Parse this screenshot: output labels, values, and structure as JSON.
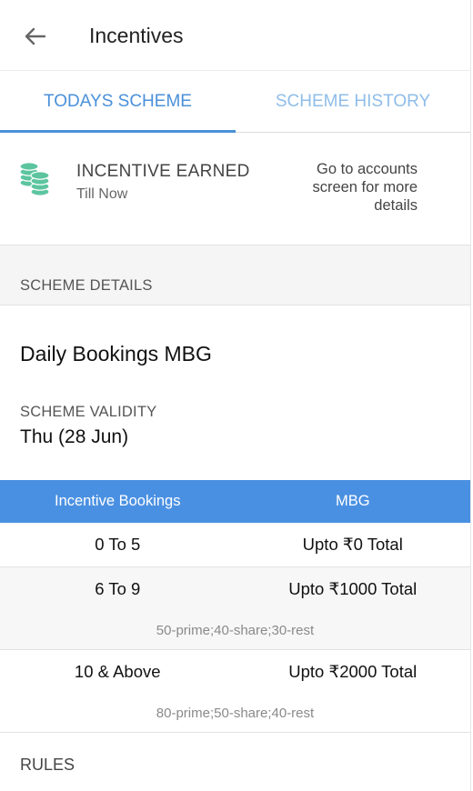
{
  "header": {
    "title": "Incentives",
    "back_icon": "arrow-left-icon"
  },
  "tabs": [
    {
      "label": "TODAYS SCHEME",
      "active": true
    },
    {
      "label": "SCHEME HISTORY",
      "active": false
    }
  ],
  "incentive": {
    "icon": "coins-icon",
    "title": "INCENTIVE EARNED",
    "subtitle": "Till Now",
    "note": "Go to accounts screen for more details"
  },
  "scheme": {
    "section_label": "SCHEME DETAILS",
    "name": "Daily Bookings MBG",
    "validity_label": "SCHEME VALIDITY",
    "validity_value": "Thu (28 Jun)"
  },
  "table": {
    "headers": [
      "Incentive Bookings",
      "MBG"
    ],
    "rows": [
      {
        "bookings": "0 To 5",
        "mbg": "Upto ₹0 Total",
        "note": ""
      },
      {
        "bookings": "6 To 9",
        "mbg": "Upto ₹1000 Total",
        "note": "50-prime;40-share;30-rest"
      },
      {
        "bookings": "10 & Above",
        "mbg": "Upto ₹2000 Total",
        "note": "80-prime;50-share;40-rest"
      }
    ]
  },
  "rules": {
    "label": "RULES"
  },
  "colors": {
    "accent": "#4a90e2",
    "tab_active": "#4a90d9",
    "tab_inactive": "#8fbde8",
    "coin": "#5cc5a0"
  }
}
